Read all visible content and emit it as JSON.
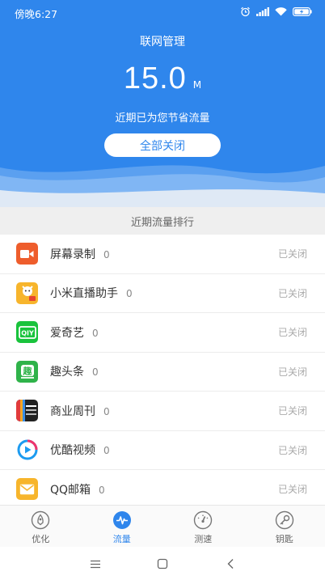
{
  "status": {
    "time": "傍晚6:27"
  },
  "header": {
    "title": "联网管理",
    "amount": "15.0",
    "unit": "M",
    "subtitle": "近期已为您节省流量",
    "close_all_label": "全部关闭"
  },
  "ranking": {
    "title": "近期流量排行",
    "items": [
      {
        "name": "屏幕录制",
        "count": "0",
        "state": "已关闭",
        "icon": "screen-record-icon",
        "color": "#ee5d2c"
      },
      {
        "name": "小米直播助手",
        "count": "0",
        "state": "已关闭",
        "icon": "xiaomi-live-icon",
        "color": "#f7b52c"
      },
      {
        "name": "爱奇艺",
        "count": "0",
        "state": "已关闭",
        "icon": "iqiyi-icon",
        "color": "#19c33c"
      },
      {
        "name": "趣头条",
        "count": "0",
        "state": "已关闭",
        "icon": "qutoutiao-icon",
        "color": "#2fb34a"
      },
      {
        "name": "商业周刊",
        "count": "0",
        "state": "已关闭",
        "icon": "business-weekly-icon",
        "color": "#222222"
      },
      {
        "name": "优酷视频",
        "count": "0",
        "state": "已关闭",
        "icon": "youku-icon",
        "color": "#1d9bf0"
      },
      {
        "name": "QQ邮箱",
        "count": "0",
        "state": "已关闭",
        "icon": "qq-mail-icon",
        "color": "#f7b52c"
      }
    ]
  },
  "tabs": [
    {
      "label": "优化",
      "icon": "optimize-icon"
    },
    {
      "label": "流量",
      "icon": "traffic-icon",
      "active": true
    },
    {
      "label": "测速",
      "icon": "speedometer-icon"
    },
    {
      "label": "钥匙",
      "icon": "key-icon"
    }
  ],
  "colors": {
    "primary": "#2f86ec",
    "wave": "#5aa2f1",
    "list_bg": "#efefef"
  }
}
